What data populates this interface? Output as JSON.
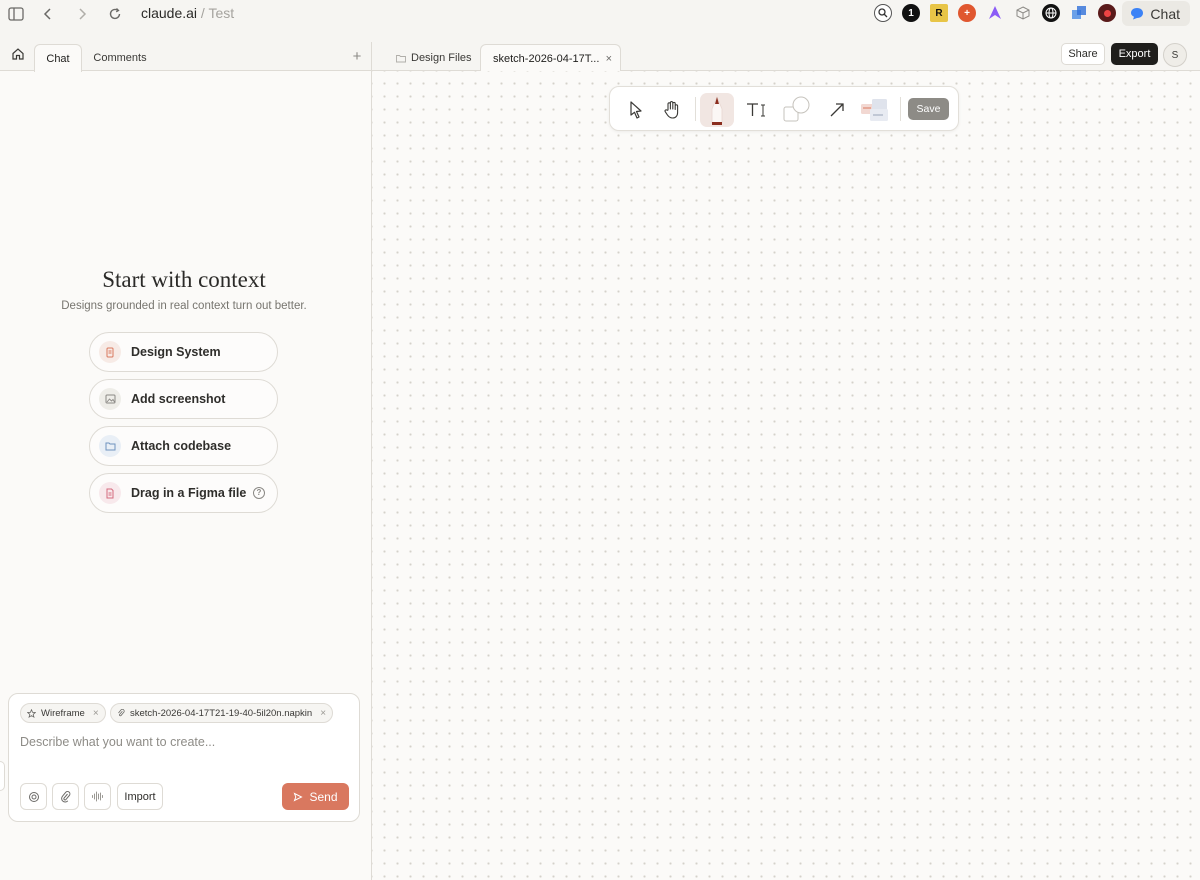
{
  "browser": {
    "url_host": "claude.ai",
    "url_path": " / Test",
    "chat_button_label": "Chat"
  },
  "left_panel": {
    "tabs": [
      {
        "label": "Chat",
        "active": true
      },
      {
        "label": "Comments",
        "active": false
      }
    ],
    "add_tab_label": "+",
    "context": {
      "title": "Start with context",
      "subtitle": "Designs grounded in real context turn out better.",
      "options": [
        {
          "label": "Design System",
          "icon": "design-system-icon"
        },
        {
          "label": "Add screenshot",
          "icon": "image-icon"
        },
        {
          "label": "Attach codebase",
          "icon": "folder-icon"
        },
        {
          "label": "Drag in a Figma file",
          "icon": "figma-file-icon"
        }
      ],
      "help_label": "?"
    },
    "composer": {
      "chips": [
        {
          "label": "Wireframe",
          "icon": "star-icon"
        },
        {
          "label": "sketch-2026-04-17T21-19-40-5il20n.napkin",
          "icon": "attachment-icon"
        }
      ],
      "placeholder": "Describe what you want to create...",
      "import_label": "Import",
      "send_label": "Send"
    }
  },
  "right_panel": {
    "tabs": [
      {
        "label": "Design Files",
        "active": false
      },
      {
        "label": "sketch-2026-04-17T...",
        "active": true
      }
    ],
    "share_label": "Share",
    "export_label": "Export",
    "avatar_initial": "S",
    "toolbar": {
      "tools": [
        "select",
        "hand",
        "pen",
        "text",
        "shapes",
        "arrow",
        "sticky"
      ],
      "active_tool": "pen",
      "save_label": "Save"
    }
  },
  "colors": {
    "accent": "#d9785f",
    "dark_button": "#1f1e1c",
    "background": "#f6f5f2"
  }
}
